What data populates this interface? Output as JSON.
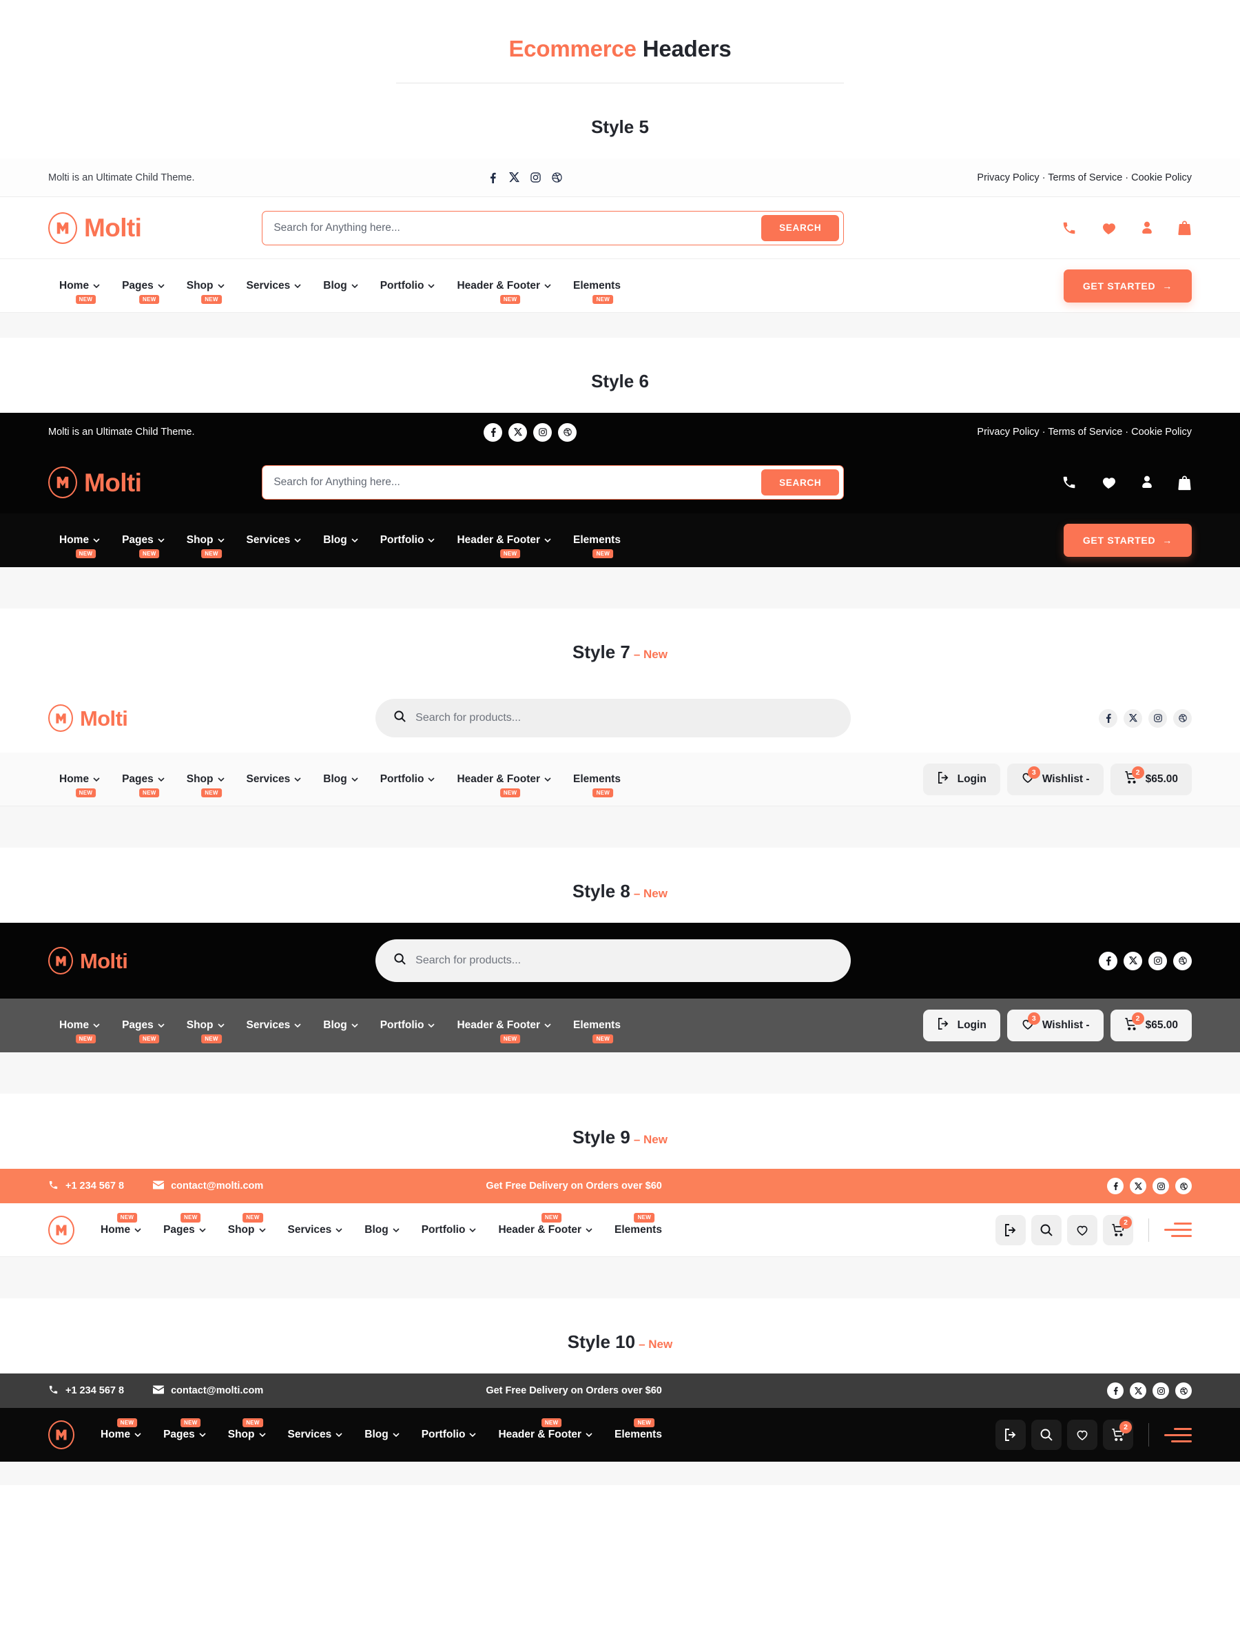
{
  "page": {
    "title_accent": "Ecommerce",
    "title_rest": " Headers"
  },
  "brand": {
    "name": "Molti",
    "accent_color": "#fb7453"
  },
  "sections": [
    {
      "label": "Style 5",
      "new": ""
    },
    {
      "label": "Style 6",
      "new": ""
    },
    {
      "label": "Style 7",
      "new": "– New"
    },
    {
      "label": "Style 8",
      "new": "– New"
    },
    {
      "label": "Style 9",
      "new": "– New"
    },
    {
      "label": "Style 10",
      "new": "– New"
    }
  ],
  "topbar": {
    "tagline": "Molti is an Ultimate Child Theme.",
    "links": [
      "Privacy Policy",
      "Terms of Service",
      "Cookie Policy"
    ],
    "links_text": "Privacy Policy · Terms of Service · Cookie Policy"
  },
  "socials": [
    {
      "name": "facebook-icon",
      "label": "f"
    },
    {
      "name": "x-twitter-icon",
      "label": "X"
    },
    {
      "name": "instagram-icon",
      "label": "ig"
    },
    {
      "name": "dribbble-icon",
      "label": "dribbble"
    }
  ],
  "search_classic": {
    "placeholder": "Search for Anything here...",
    "button": "SEARCH"
  },
  "search_pill": {
    "placeholder": "Search for products..."
  },
  "menu": [
    {
      "label": "Home",
      "caret": true,
      "new": "NEW"
    },
    {
      "label": "Pages",
      "caret": true,
      "new": "NEW"
    },
    {
      "label": "Shop",
      "caret": true,
      "new": "NEW"
    },
    {
      "label": "Services",
      "caret": true,
      "new": ""
    },
    {
      "label": "Blog",
      "caret": true,
      "new": ""
    },
    {
      "label": "Portfolio",
      "caret": true,
      "new": ""
    },
    {
      "label": "Header & Footer",
      "caret": true,
      "new": "NEW"
    },
    {
      "label": "Elements",
      "caret": false,
      "new": "NEW"
    }
  ],
  "cta": {
    "label": "GET STARTED",
    "arrow": "→"
  },
  "actions": {
    "login": "Login",
    "wishlist": "Wishlist -",
    "wishlist_count": "3",
    "cart_total": "$65.00",
    "cart_count": "2"
  },
  "promo": {
    "phone": "+1 234 567 8",
    "email": "contact@molti.com",
    "message": "Get Free Delivery on Orders over $60"
  },
  "icons": {
    "phone": "phone-icon",
    "heart": "heart-icon",
    "user": "user-icon",
    "bag": "shopping-bag-icon",
    "search": "search-icon",
    "login": "login-icon",
    "cart": "cart-icon",
    "menu": "hamburger-menu-icon",
    "mail": "mail-icon"
  },
  "colors": {
    "accent": "#fb7453",
    "promo_orange": "#fb8059",
    "dark": "#050505",
    "gray_nav": "#555555",
    "dark_promo": "#3d3d3d"
  }
}
